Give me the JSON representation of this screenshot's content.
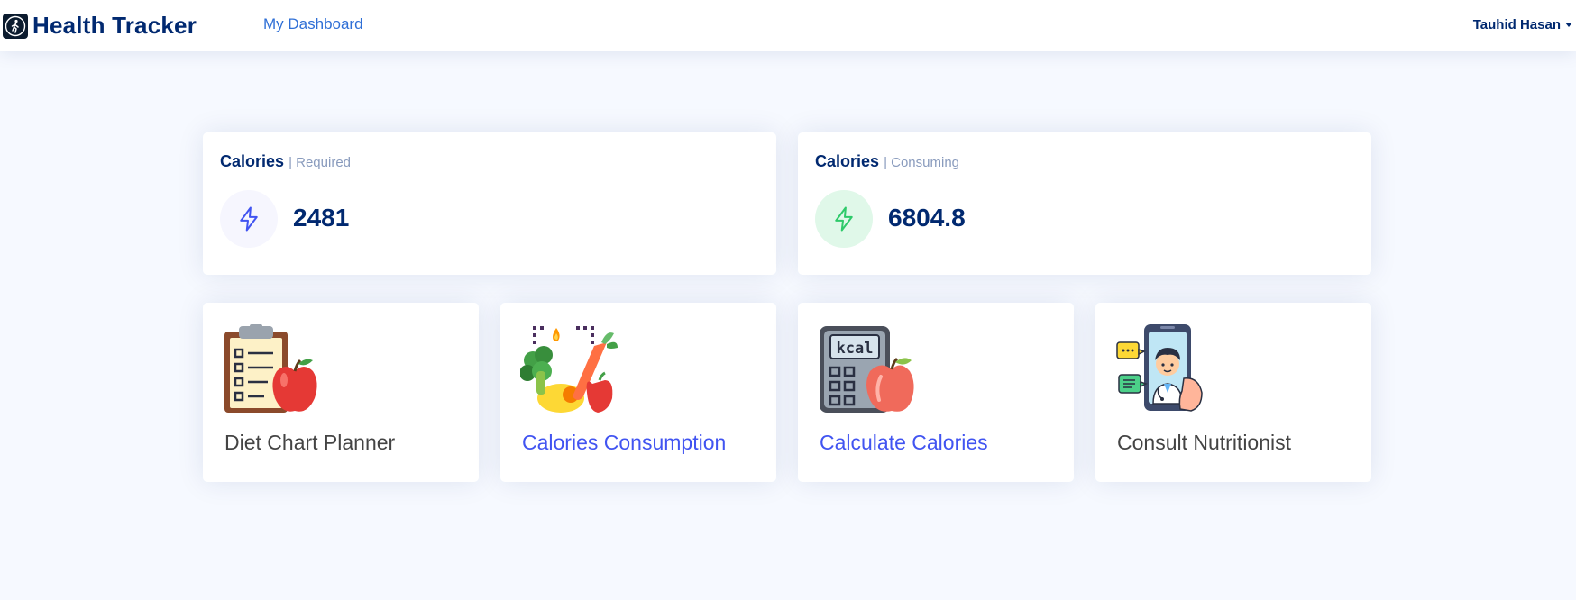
{
  "header": {
    "brand": "Health Tracker",
    "nav_link": "My Dashboard",
    "user_name": "Tauhid Hasan"
  },
  "stats": [
    {
      "title": "Calories",
      "subtitle": "| Required",
      "value": "2481",
      "icon": "lightning-icon",
      "icon_color": "#4154f1",
      "icon_bg": "#f6f6fe"
    },
    {
      "title": "Calories",
      "subtitle": "| Consuming",
      "value": "6804.8",
      "icon": "lightning-icon",
      "icon_color": "#2eca6a",
      "icon_bg": "#e0f8e9"
    }
  ],
  "tiles": [
    {
      "label": "Diet Chart Planner",
      "icon": "clipboard-apple-icon"
    },
    {
      "label": "Calories Consumption",
      "icon": "vegetables-icon"
    },
    {
      "label": "Calculate Calories",
      "icon": "kcal-calculator-icon"
    },
    {
      "label": "Consult Nutritionist",
      "icon": "doctor-phone-icon"
    }
  ],
  "colors": {
    "brand": "#012970",
    "accent": "#4154f1",
    "success": "#2eca6a",
    "page_bg": "#f6f9ff"
  }
}
